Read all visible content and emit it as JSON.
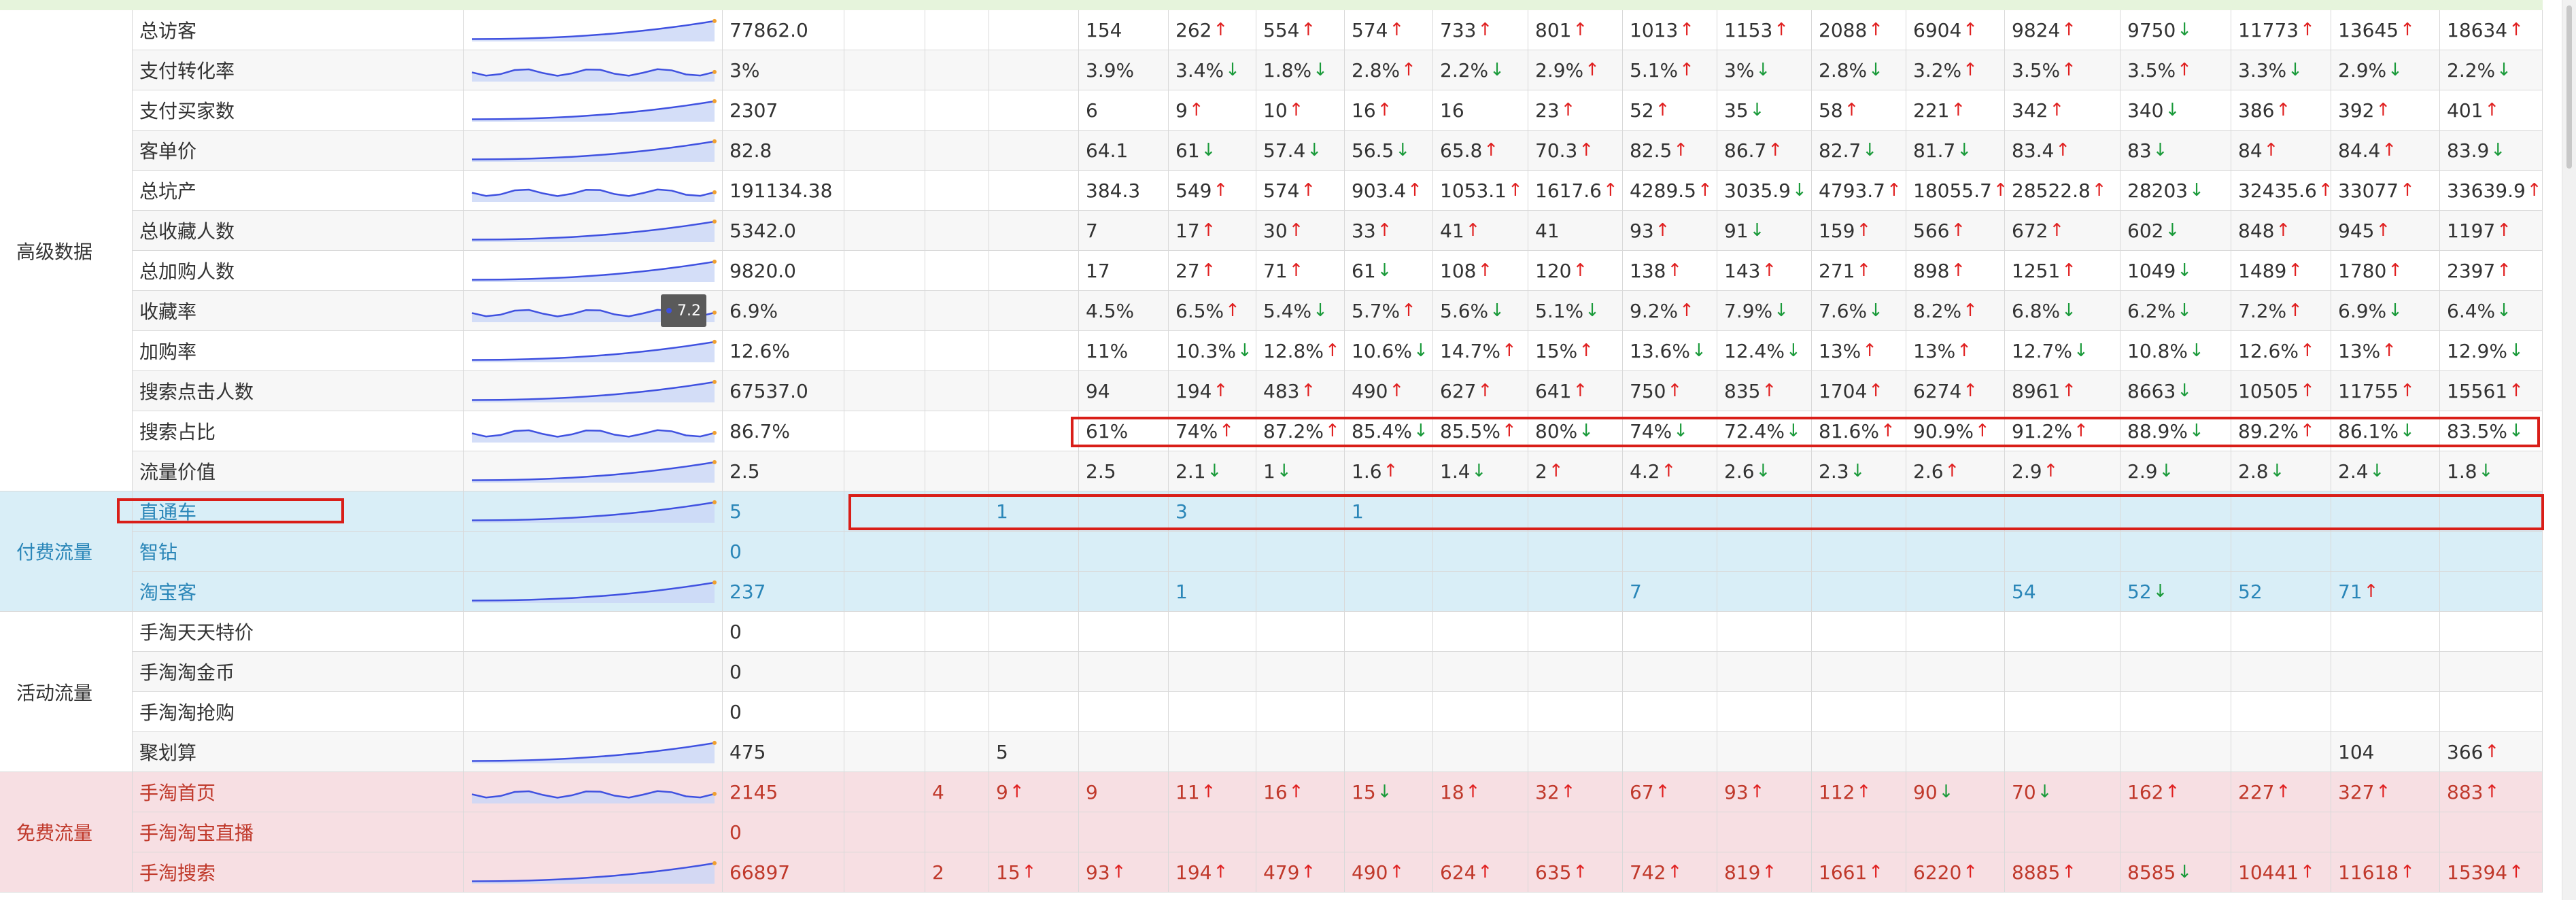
{
  "groups": [
    {
      "label": "高级数据",
      "theme": "white",
      "rows": [
        {
          "name": "总访客",
          "total": "77862.0",
          "vals": [
            "",
            "",
            "154",
            "262↑",
            "554↑",
            "574↑",
            "733↑",
            "801↑",
            "1013↑",
            "1153↑",
            "2088↑",
            "6904↑",
            "9824↑",
            "9750↓",
            "11773↑",
            "13645↑",
            "18634↑"
          ]
        },
        {
          "name": "支付转化率",
          "total": "3%",
          "vals": [
            "",
            "",
            "3.9%",
            "3.4%↓",
            "1.8%↓",
            "2.8%↑",
            "2.2%↓",
            "2.9%↑",
            "5.1%↑",
            "3%↓",
            "2.8%↓",
            "3.2%↑",
            "3.5%↑",
            "3.5%↑",
            "3.3%↓",
            "2.9%↓",
            "2.2%↓"
          ]
        },
        {
          "name": "支付买家数",
          "total": "2307",
          "vals": [
            "",
            "",
            "6",
            "9↑",
            "10↑",
            "16↑",
            "16",
            "23↑",
            "52↑",
            "35↓",
            "58↑",
            "221↑",
            "342↑",
            "340↓",
            "386↑",
            "392↑",
            "401↑"
          ]
        },
        {
          "name": "客单价",
          "total": "82.8",
          "vals": [
            "",
            "",
            "64.1",
            "61↓",
            "57.4↓",
            "56.5↓",
            "65.8↑",
            "70.3↑",
            "82.5↑",
            "86.7↑",
            "82.7↓",
            "81.7↓",
            "83.4↑",
            "83↓",
            "84↑",
            "84.4↑",
            "83.9↓"
          ]
        },
        {
          "name": "总坑产",
          "total": "191134.38",
          "vals": [
            "",
            "",
            "384.3",
            "549↑",
            "574↑",
            "903.4↑",
            "1053.1↑",
            "1617.6↑",
            "4289.5↑",
            "3035.9↓",
            "4793.7↑",
            "18055.7↑",
            "28522.8↑",
            "28203↓",
            "32435.6↑",
            "33077↑",
            "33639.9↑"
          ]
        },
        {
          "name": "总收藏人数",
          "total": "5342.0",
          "vals": [
            "",
            "",
            "7",
            "17↑",
            "30↑",
            "33↑",
            "41↑",
            "41",
            "93↑",
            "91↓",
            "159↑",
            "566↑",
            "672↑",
            "602↓",
            "848↑",
            "945↑",
            "1197↑"
          ]
        },
        {
          "name": "总加购人数",
          "total": "9820.0",
          "vals": [
            "",
            "",
            "17",
            "27↑",
            "71↑",
            "61↓",
            "108↑",
            "120↑",
            "138↑",
            "143↑",
            "271↑",
            "898↑",
            "1251↑",
            "1049↓",
            "1489↑",
            "1780↑",
            "2397↑"
          ]
        },
        {
          "name": "收藏率",
          "total": "6.9%",
          "vals": [
            "",
            "",
            "4.5%",
            "6.5%↑",
            "5.4%↓",
            "5.7%↑",
            "5.6%↓",
            "5.1%↓",
            "9.2%↑",
            "7.9%↓",
            "7.6%↓",
            "8.2%↑",
            "6.8%↓",
            "6.2%↓",
            "7.2%↑",
            "6.9%↓",
            "6.4%↓"
          ]
        },
        {
          "name": "加购率",
          "total": "12.6%",
          "vals": [
            "",
            "",
            "11%",
            "10.3%↓",
            "12.8%↑",
            "10.6%↓",
            "14.7%↑",
            "15%↑",
            "13.6%↓",
            "12.4%↓",
            "13%↑",
            "13%↑",
            "12.7%↓",
            "10.8%↓",
            "12.6%↑",
            "13%↑",
            "12.9%↓"
          ]
        },
        {
          "name": "搜索点击人数",
          "total": "67537.0",
          "vals": [
            "",
            "",
            "94",
            "194↑",
            "483↑",
            "490↑",
            "627↑",
            "641↑",
            "750↑",
            "835↑",
            "1704↑",
            "6274↑",
            "8961↑",
            "8663↓",
            "10505↑",
            "11755↑",
            "15561↑"
          ]
        },
        {
          "name": "搜索占比",
          "total": "86.7%",
          "vals": [
            "",
            "",
            "61%",
            "74%↑",
            "87.2%↑",
            "85.4%↓",
            "85.5%↑",
            "80%↓",
            "74%↓",
            "72.4%↓",
            "81.6%↑",
            "90.9%↑",
            "91.2%↑",
            "88.9%↓",
            "89.2%↑",
            "86.1%↓",
            "83.5%↓"
          ]
        },
        {
          "name": "流量价值",
          "total": "2.5",
          "vals": [
            "",
            "",
            "2.5",
            "2.1↓",
            "1↓",
            "1.6↑",
            "1.4↓",
            "2↑",
            "4.2↑",
            "2.6↓",
            "2.3↓",
            "2.6↑",
            "2.9↑",
            "2.9↓",
            "2.8↓",
            "2.4↓",
            "1.8↓"
          ]
        }
      ]
    },
    {
      "label": "付费流量",
      "theme": "blue",
      "rows": [
        {
          "name": "直通车",
          "total": "5",
          "vals": [
            "",
            "1",
            "",
            "3",
            "",
            "1",
            "",
            "",
            "",
            "",
            "",
            "",
            "",
            "",
            "",
            "",
            ""
          ]
        },
        {
          "name": "智钻",
          "total": "0",
          "vals": [
            "",
            "",
            "",
            "",
            "",
            "",
            "",
            "",
            "",
            "",
            "",
            "",
            "",
            "",
            "",
            "",
            ""
          ]
        },
        {
          "name": "淘宝客",
          "total": "237",
          "vals": [
            "",
            "",
            "",
            "1",
            "",
            "",
            "",
            "",
            "7",
            "",
            "",
            "",
            "54",
            "52↓",
            "52",
            "71↑",
            ""
          ]
        }
      ]
    },
    {
      "label": "活动流量",
      "theme": "white",
      "rows": [
        {
          "name": "手淘天天特价",
          "total": "0",
          "vals": [
            "",
            "",
            "",
            "",
            "",
            "",
            "",
            "",
            "",
            "",
            "",
            "",
            "",
            "",
            "",
            "",
            ""
          ]
        },
        {
          "name": "手淘淘金币",
          "total": "0",
          "vals": [
            "",
            "",
            "",
            "",
            "",
            "",
            "",
            "",
            "",
            "",
            "",
            "",
            "",
            "",
            "",
            "",
            ""
          ]
        },
        {
          "name": "手淘淘抢购",
          "total": "0",
          "vals": [
            "",
            "",
            "",
            "",
            "",
            "",
            "",
            "",
            "",
            "",
            "",
            "",
            "",
            "",
            "",
            "",
            ""
          ]
        },
        {
          "name": "聚划算",
          "total": "475",
          "vals": [
            "",
            "5",
            "",
            "",
            "",
            "",
            "",
            "",
            "",
            "",
            "",
            "",
            "",
            "",
            "",
            "104",
            "366↑"
          ]
        }
      ]
    },
    {
      "label": "免费流量",
      "theme": "pink",
      "rows": [
        {
          "name": "手淘首页",
          "total": "2145",
          "vals": [
            "4",
            "9↑",
            "9",
            "11↑",
            "16↑",
            "15↓",
            "18↑",
            "32↑",
            "67↑",
            "93↑",
            "112↑",
            "90↓",
            "70↓",
            "162↑",
            "227↑",
            "327↑",
            "883↑"
          ]
        },
        {
          "name": "手淘淘宝直播",
          "total": "0",
          "vals": [
            "",
            "",
            "",
            "",
            "",
            "",
            "",
            "",
            "",
            "",
            "",
            "",
            "",
            "",
            "",
            "",
            ""
          ]
        },
        {
          "name": "手淘搜索",
          "total": "66897",
          "vals": [
            "2",
            "15↑",
            "93↑",
            "194↑",
            "479↑",
            "490↑",
            "624↑",
            "635↑",
            "742↑",
            "819↑",
            "1661↑",
            "6220↑",
            "8885↑",
            "8585↓",
            "10441↑",
            "11618↑",
            "15394↑"
          ]
        }
      ]
    }
  ],
  "tooltip": {
    "value": "7.2"
  },
  "colors": {
    "green": "#e6f4dc",
    "blue": "#d9eef7",
    "pink": "#f7dfe3",
    "blueText": "#2a86b8",
    "pinkText": "#c0392b",
    "up": "#e02020",
    "down": "#1a9a3a",
    "line": "#3f51e0",
    "area": "#c9d6f6",
    "highlight": "#d91e18"
  }
}
